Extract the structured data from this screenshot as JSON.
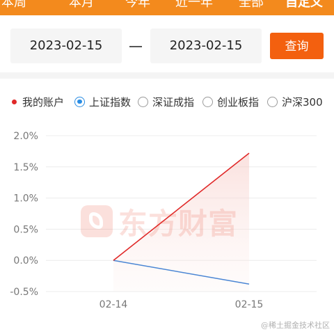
{
  "tabs": [
    {
      "label": "本周",
      "active": false
    },
    {
      "label": "本月",
      "active": false
    },
    {
      "label": "今年",
      "active": false
    },
    {
      "label": "近一年",
      "active": false
    },
    {
      "label": "全部",
      "active": false
    },
    {
      "label": "自定义",
      "active": true
    }
  ],
  "date_range": {
    "start": "2023-02-15",
    "end": "2023-02-15",
    "query_label": "查询"
  },
  "legend": {
    "my_account": "我的账户",
    "options": [
      {
        "label": "上证指数",
        "checked": true
      },
      {
        "label": "深证成指",
        "checked": false
      },
      {
        "label": "创业板指",
        "checked": false
      },
      {
        "label": "沪深300",
        "checked": false
      }
    ]
  },
  "watermark": "东方财富",
  "credit": "@稀土掘金技术社区",
  "colors": {
    "brand_orange": "#f38a1d",
    "query_button": "#f3600f",
    "my_account_line": "#e02828",
    "index_line": "#4a86d4",
    "radio_checked": "#2b8de3"
  },
  "chart_data": {
    "type": "line",
    "x": [
      "02-14",
      "02-15"
    ],
    "series": [
      {
        "name": "我的账户",
        "values": [
          0.0,
          1.72
        ]
      },
      {
        "name": "上证指数",
        "values": [
          0.0,
          -0.38
        ]
      }
    ],
    "yticks": [
      "2.0%",
      "1.5%",
      "1.0%",
      "0.5%",
      "0.0%",
      "-0.5%"
    ],
    "ylim": [
      -0.5,
      2.0
    ],
    "grid": "horizontal"
  }
}
